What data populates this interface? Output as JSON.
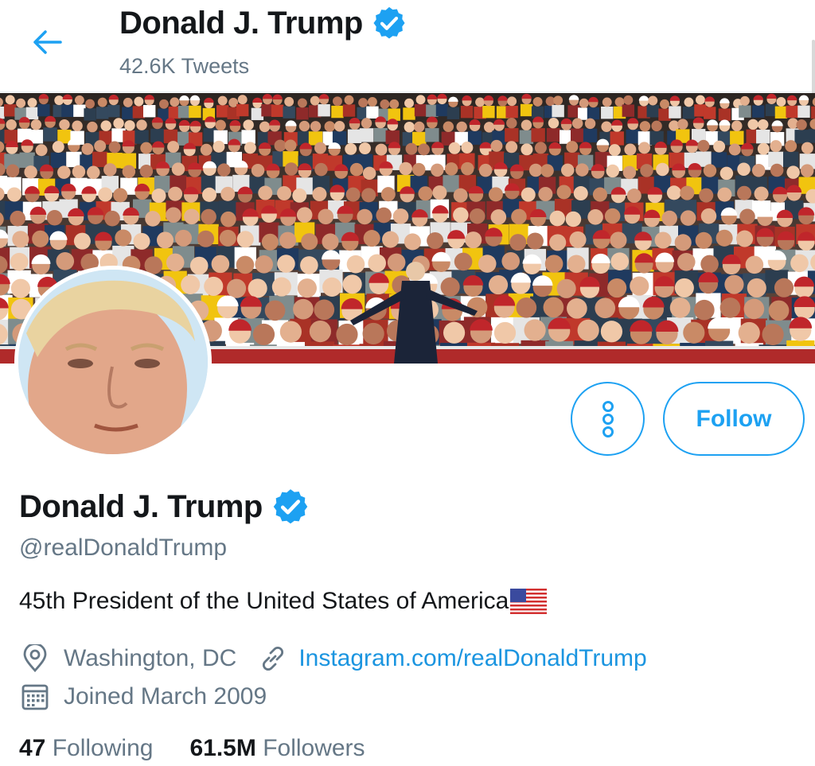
{
  "header": {
    "name": "Donald J. Trump",
    "tweet_count": "42.6K Tweets",
    "back_icon": "arrow-left-icon"
  },
  "profile": {
    "name": "Donald J. Trump",
    "handle": "@realDonaldTrump",
    "bio": "45th President of the United States of America",
    "verified_icon": "verified-badge-icon",
    "location": "Washington, DC",
    "website": "Instagram.com/realDonaldTrump",
    "joined": "Joined March 2009",
    "following_count": "47",
    "following_label": "Following",
    "followers_count": "61.5M",
    "followers_label": "Followers"
  },
  "actions": {
    "follow_label": "Follow",
    "more_icon": "more-vertical-icon"
  },
  "colors": {
    "accent": "#1da1f2",
    "link": "#1b95e0",
    "secondary_text": "#657786",
    "primary_text": "#14171a"
  }
}
